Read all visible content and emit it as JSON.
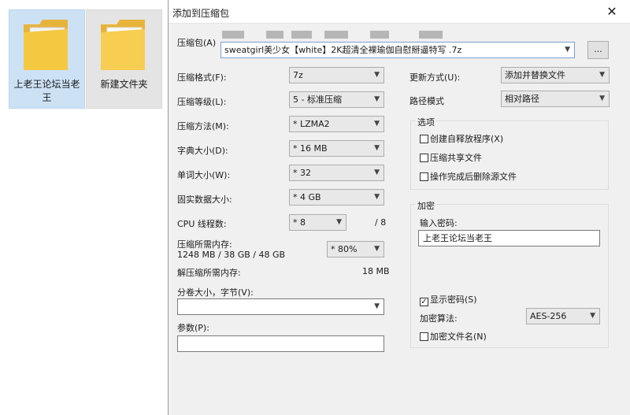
{
  "desktop": {
    "icons": [
      {
        "label": "上老王论坛当老王"
      },
      {
        "label": "新建文件夹"
      }
    ]
  },
  "dialog": {
    "title": "添加到压缩包",
    "archive_label": "压缩包(A)",
    "archive_value": "sweatgirl美少女【white】2K超清全裸瑜伽自慰掰逼特写 .7z",
    "browse_label": "...",
    "format": {
      "label": "压缩格式(F):",
      "value": "7z"
    },
    "level": {
      "label": "压缩等级(L):",
      "value": "5 - 标准压缩"
    },
    "method": {
      "label": "压缩方法(M):",
      "value": "* LZMA2"
    },
    "dict": {
      "label": "字典大小(D):",
      "value": "* 16 MB"
    },
    "word": {
      "label": "单词大小(W):",
      "value": "* 32"
    },
    "solid": {
      "label": "固实数据大小:",
      "value": "* 4 GB"
    },
    "threads": {
      "label": "CPU 线程数:",
      "value": "* 8",
      "total": "/ 8"
    },
    "memory": {
      "label": "压缩所需内存:",
      "detail": "1248 MB / 38 GB / 48 GB",
      "value": "* 80%"
    },
    "decomp_memory": {
      "label": "解压缩所需内存:",
      "value": "18 MB"
    },
    "volume": {
      "label": "分卷大小，字节(V):",
      "value": ""
    },
    "params": {
      "label": "参数(P):",
      "value": ""
    },
    "update": {
      "label": "更新方式(U):",
      "value": "添加并替换文件"
    },
    "path_mode": {
      "label": "路径模式",
      "value": "相对路径"
    },
    "options": {
      "title": "选项",
      "sfx": "创建自释放程序(X)",
      "shared": "压缩共享文件",
      "delete": "操作完成后删除源文件"
    },
    "encryption": {
      "title": "加密",
      "password_label": "输入密码:",
      "password_value": "上老王论坛当老王",
      "show_password": "显示密码(S)",
      "method_label": "加密算法:",
      "method_value": "AES-256",
      "encrypt_names": "加密文件名(N)"
    }
  },
  "colors": {
    "selection": "#cde1f5",
    "dialog_bg": "#f0f0f0",
    "folder": "#f5c842"
  }
}
